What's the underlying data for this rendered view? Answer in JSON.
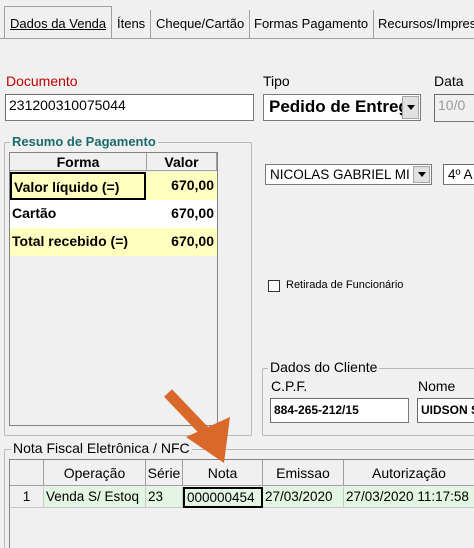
{
  "tabs": [
    {
      "label": "Dados da Venda",
      "active": true
    },
    {
      "label": "Ítens"
    },
    {
      "label": "Cheque/Cartão"
    },
    {
      "label": "Formas Pagamento"
    },
    {
      "label": "Recursos/Impres"
    }
  ],
  "documento": {
    "label": "Documento",
    "value": "231200310075044"
  },
  "tipo": {
    "label": "Tipo",
    "value": "Pedido de Entreg"
  },
  "data": {
    "label": "Data",
    "value": "10/0"
  },
  "resumo": {
    "title": "Resumo de Pagamento",
    "headers": {
      "forma": "Forma",
      "valor": "Valor"
    },
    "rows": [
      {
        "forma": "Valor líquido (=)",
        "valor": "670,00"
      },
      {
        "forma": "Cartão",
        "valor": "670,00"
      },
      {
        "forma": "Total recebido (=)",
        "valor": "670,00"
      }
    ]
  },
  "vendedor": {
    "value": "NICOLAS GABRIEL MI"
  },
  "segundo_combo": {
    "value": "4º A"
  },
  "retirada": {
    "label": "Retirada de Funcionário",
    "checked": false
  },
  "cliente": {
    "title": "Dados do Cliente",
    "cpf_label": "C.P.F.",
    "cpf_value": "884-265-212/15",
    "nome_label": "Nome",
    "nome_value": "UIDSON S"
  },
  "nfe": {
    "title": "Nota Fiscal Eletrônica / NFC",
    "headers": {
      "operacao": "Operação",
      "serie": "Série",
      "nota": "Nota",
      "emissao": "Emissao",
      "autorizacao": "Autorização"
    },
    "rows": [
      {
        "num": "1",
        "operacao": "Venda S/ Estoq",
        "serie": "23",
        "nota": "000000454",
        "emissao": "27/03/2020",
        "autorizacao": "27/03/2020 11:17:58"
      }
    ]
  },
  "colors": {
    "accent_red": "#c00000",
    "highlight_yellow": "#ffffc0",
    "row_green": "#e3f5e3",
    "arrow_orange": "#d9692a"
  }
}
